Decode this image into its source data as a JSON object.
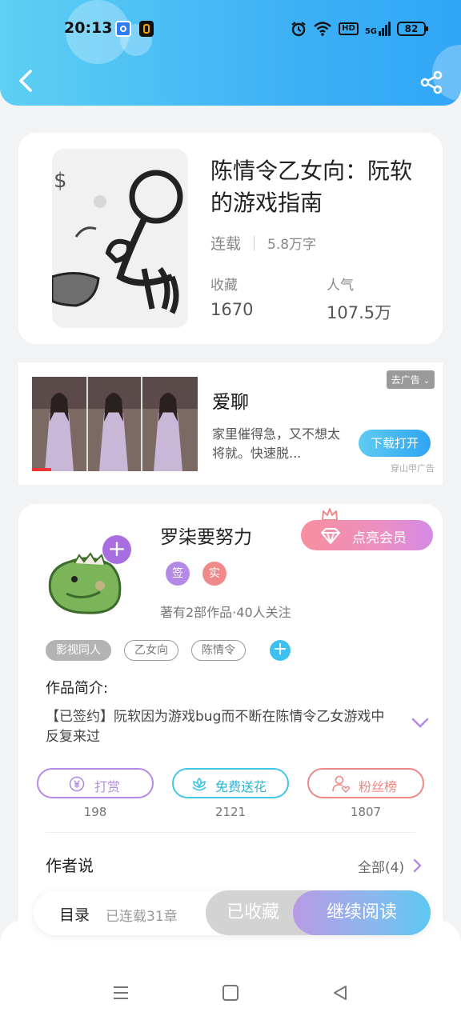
{
  "status_bar": {
    "time": "20:13",
    "hd_label": "HD",
    "signal_label": "5G",
    "battery": "82"
  },
  "book": {
    "title": "陈情令乙女向：阮软的游戏指南",
    "status": "连载",
    "word_count": "5.8万字",
    "favorites_label": "收藏",
    "favorites_value": "1670",
    "popularity_label": "人气",
    "popularity_value": "107.5万"
  },
  "ad": {
    "title": "爱聊",
    "description": "家里催得急，又不想太将就。快速脱...",
    "remove_label": "去广告",
    "download_label": "下载打开",
    "source": "穿山甲广告"
  },
  "author": {
    "name": "罗柒要努力",
    "badge_signed": "签",
    "badge_real": "实",
    "info": "著有2部作品·40人关注",
    "vip_label": "点亮会员",
    "follow_plus": "+"
  },
  "tags": {
    "items": [
      "影视同人",
      "乙女向",
      "陈情令"
    ],
    "add": "+"
  },
  "intro": {
    "label": "作品简介:",
    "text": "【已签约】阮软因为游戏bug而不断在陈情令乙女游戏中反复来过"
  },
  "actions": {
    "tip_label": "打赏",
    "tip_count": "198",
    "flower_label": "免费送花",
    "flower_count": "2121",
    "fans_label": "粉丝榜",
    "fans_count": "1807"
  },
  "author_says": {
    "title": "作者说",
    "all_label": "全部(4)"
  },
  "bottom_bar": {
    "toc_label": "目录",
    "chapter_count": "已连载31章",
    "favorited_label": "已收藏",
    "continue_label": "继续阅读"
  },
  "colors": {
    "header_blue": "#3fb2f5",
    "vip_pink": "#f78f9e",
    "tip_purple": "#b58ae6",
    "flower_cyan": "#42c6e6",
    "fans_red": "#ee8886"
  },
  "icons": [
    "back-arrow-icon",
    "share-icon",
    "crown-icon",
    "diamond-icon",
    "yen-icon",
    "flower-icon",
    "user-heart-icon",
    "chevron-right-icon",
    "chevron-down-icon",
    "menu-icon",
    "home-square-icon",
    "back-triangle-icon"
  ]
}
